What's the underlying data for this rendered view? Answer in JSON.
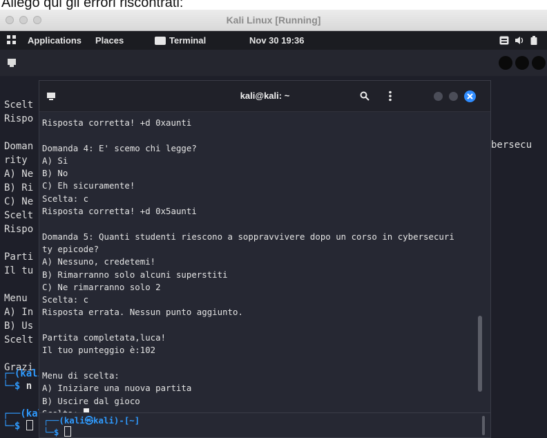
{
  "caption": "Allego qui gli errori riscontrati:",
  "vbox": {
    "title": "Kali Linux [Running]"
  },
  "panel": {
    "applications": "Applications",
    "places": "Places",
    "terminal": "Terminal",
    "datetime": "Nov 30 19:36"
  },
  "bg_terminal": {
    "right_fragment": "bersecu",
    "lines": [
      "Scelt",
      "Rispo",
      "",
      "Doman",
      "rity ",
      "A) Ne",
      "B) Ri",
      "C) Ne",
      "Scelt",
      "Rispo",
      "",
      "Parti",
      "Il tu",
      "",
      "Menu ",
      "A) In",
      "B) Us",
      "Scelt",
      "",
      "Grazi"
    ],
    "prompt_user": "kali",
    "prompt_bottom": "(kali㉿kali)-[~]",
    "prompt_char": "$"
  },
  "fg_terminal": {
    "title": "kali@kali: ~",
    "lines": [
      "Risposta corretta! +d 0xaunti",
      "",
      "Domanda 4: E' scemo chi legge?",
      "A) Si",
      "B) No",
      "C) Eh sicuramente!",
      "Scelta: c",
      "Risposta corretta! +d 0x5aunti",
      "",
      "Domanda 5: Quanti studenti riescono a soppravvivere dopo un corso in cybersecuri",
      "ty epicode?",
      "A) Nessuno, credetemi!",
      "B) Rimarranno solo alcuni superstiti",
      "C) Ne rimarranno solo 2",
      "Scelta: c",
      "Risposta errata. Nessun punto aggiunto.",
      "",
      "Partita completata,luca!",
      "Il tuo punteggio è:102",
      "",
      "Menu di scelta:",
      "A) Iniziare una nuova partita",
      "B) Uscire dal gioco"
    ],
    "last_prompt": "Scelta: ",
    "mini_prompt": "(kali㉿kali)-[~]",
    "mini_char": "$"
  }
}
